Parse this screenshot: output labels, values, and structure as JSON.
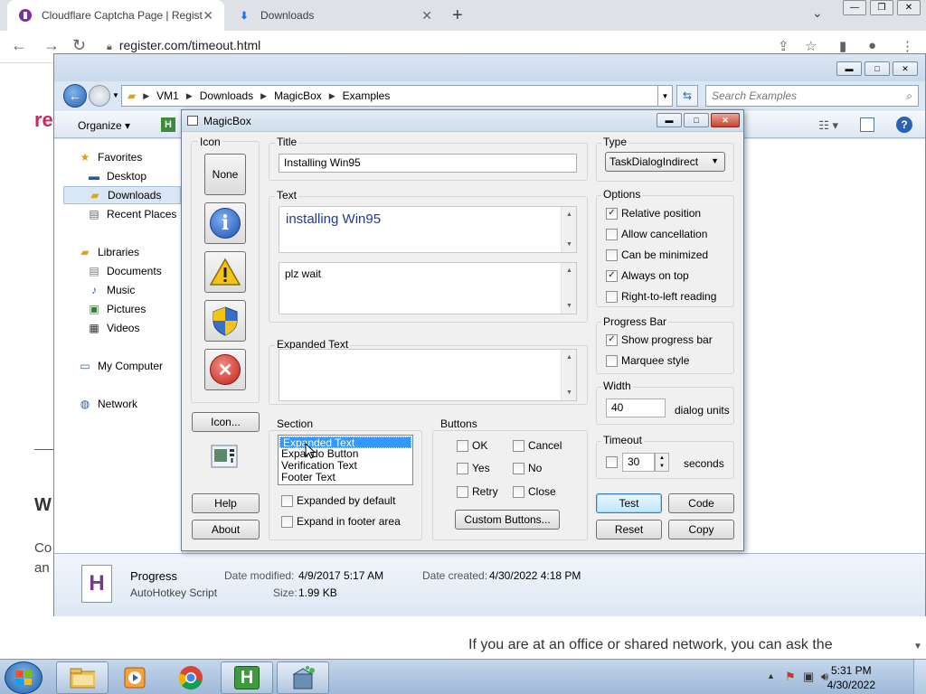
{
  "browser": {
    "tabs": [
      {
        "title": "Cloudflare Captcha Page | Regist",
        "active": true
      },
      {
        "title": "Downloads",
        "active": false
      }
    ],
    "url": "register.com/timeout.html"
  },
  "web": {
    "logo": "re",
    "heading": "W",
    "para_line1": "Co",
    "para_line2": "an",
    "bottom_text": "If you are at an office or shared network, you can ask the"
  },
  "explorer": {
    "breadcrumbs": [
      "VM1",
      "Downloads",
      "MagicBox",
      "Examples"
    ],
    "search_placeholder": "Search Examples",
    "organize_label": "Organize",
    "nav": {
      "favorites": "Favorites",
      "desktop": "Desktop",
      "downloads": "Downloads",
      "recent": "Recent Places",
      "libraries": "Libraries",
      "documents": "Documents",
      "music": "Music",
      "pictures": "Pictures",
      "videos": "Videos",
      "computer": "My Computer",
      "network": "Network"
    },
    "details": {
      "name": "Progress",
      "type": "AutoHotkey Script",
      "modified_label": "Date modified:",
      "modified_value": "4/9/2017 5:17 AM",
      "created_label": "Date created:",
      "created_value": "4/30/2022 4:18 PM",
      "size_label": "Size:",
      "size_value": "1.99 KB"
    }
  },
  "magicbox": {
    "title": "MagicBox",
    "icon_group": "Icon",
    "icon_none": "None",
    "icon_more": "Icon...",
    "help": "Help",
    "about": "About",
    "title_group": "Title",
    "title_value": "Installing Win95",
    "text_group": "Text",
    "main_text": "installing Win95",
    "content_text": "plz wait",
    "expanded_group": "Expanded Text",
    "expanded_value": "",
    "section_group": "Section",
    "sections": [
      "Expanded Text",
      "Expando Button",
      "Verification Text",
      "Footer Text"
    ],
    "expanded_by_default": "Expanded by default",
    "expand_in_footer": "Expand in footer area",
    "buttons_group": "Buttons",
    "btn_ok": "OK",
    "btn_cancel": "Cancel",
    "btn_yes": "Yes",
    "btn_no": "No",
    "btn_retry": "Retry",
    "btn_close": "Close",
    "custom_buttons": "Custom Buttons...",
    "type_group": "Type",
    "type_value": "TaskDialogIndirect",
    "options_group": "Options",
    "opt_relative": "Relative position",
    "opt_allow_cancel": "Allow cancellation",
    "opt_minimized": "Can be minimized",
    "opt_on_top": "Always on top",
    "opt_rtl": "Right-to-left reading",
    "progress_group": "Progress Bar",
    "show_progress": "Show progress bar",
    "marquee": "Marquee style",
    "width_group": "Width",
    "width_value": "40",
    "width_units": "dialog units",
    "timeout_group": "Timeout",
    "timeout_value": "30",
    "timeout_units": "seconds",
    "test": "Test",
    "code": "Code",
    "reset": "Reset",
    "copy": "Copy"
  },
  "taskbar": {
    "time": "5:31 PM",
    "date": "4/30/2022"
  },
  "icons": {
    "info_glyph": "i",
    "error_glyph": "✕",
    "checkmark": "✓"
  }
}
